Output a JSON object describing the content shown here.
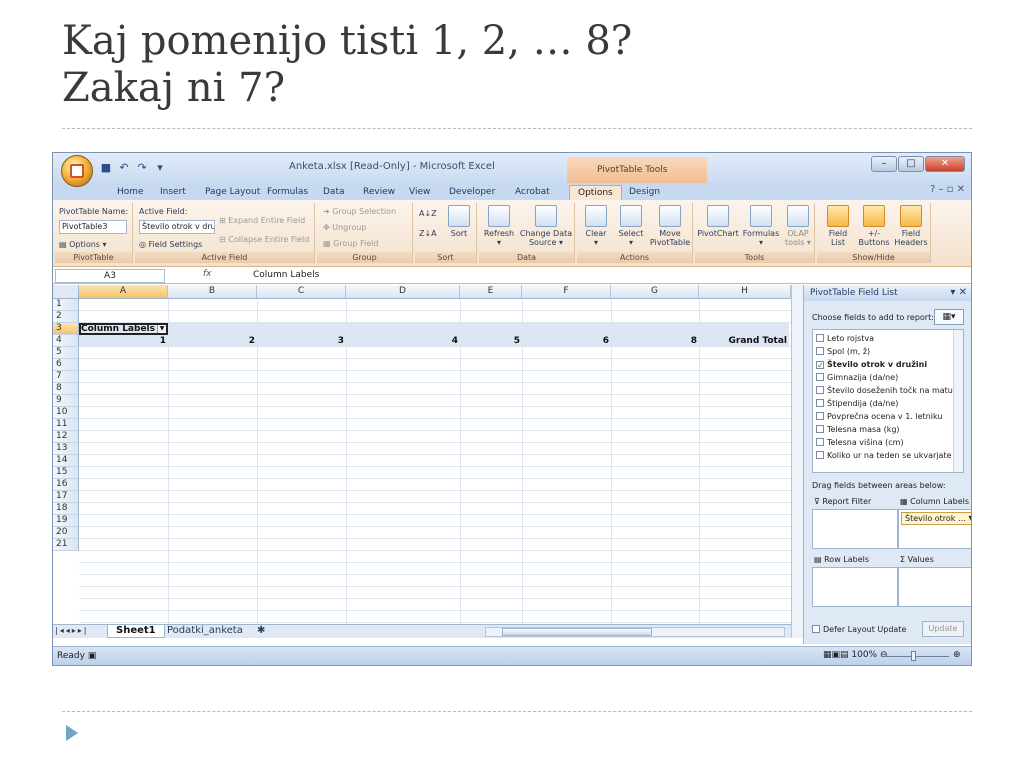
{
  "slide": {
    "title_line1": "Kaj pomenijo tisti 1, 2, … 8?",
    "title_line2": "Zakaj ni 7?"
  },
  "window": {
    "title": "Anketa.xlsx  [Read-Only] - Microsoft Excel",
    "context_tab_title": "PivotTable Tools"
  },
  "ribbon_tabs": [
    "Home",
    "Insert",
    "Page Layout",
    "Formulas",
    "Data",
    "Review",
    "View",
    "Developer",
    "Acrobat",
    "Options",
    "Design"
  ],
  "active_tab": "Options",
  "ribbon": {
    "pivottable": {
      "name_label": "PivotTable Name:",
      "name_value": "PivotTable3",
      "options": "Options",
      "group": "PivotTable"
    },
    "active_field": {
      "label": "Active Field:",
      "value": "Število otrok v dru",
      "field_settings": "Field Settings",
      "expand": "Expand Entire Field",
      "collapse": "Collapse Entire Field",
      "group": "Active Field"
    },
    "group_grp": {
      "group_selection": "Group Selection",
      "ungroup": "Ungroup",
      "group_field": "Group Field",
      "group": "Group"
    },
    "sort_grp": {
      "sort": "Sort",
      "group": "Sort"
    },
    "data_grp": {
      "refresh": "Refresh",
      "change_source_1": "Change Data",
      "change_source_2": "Source",
      "group": "Data"
    },
    "actions_grp": {
      "clear": "Clear",
      "select": "Select",
      "move_1": "Move",
      "move_2": "PivotTable",
      "group": "Actions"
    },
    "tools_grp": {
      "pivotchart": "PivotChart",
      "formulas": "Formulas",
      "olap_1": "OLAP",
      "olap_2": "tools",
      "group": "Tools"
    },
    "showhide_grp": {
      "field_list_1": "Field",
      "field_list_2": "List",
      "buttons_1": "+/-",
      "buttons_2": "Buttons",
      "headers_1": "Field",
      "headers_2": "Headers",
      "group": "Show/Hide"
    }
  },
  "formula_bar": {
    "name_box": "A3",
    "fx": "fx",
    "value": "Column Labels"
  },
  "columns": [
    "A",
    "B",
    "C",
    "D",
    "E",
    "F",
    "G",
    "H"
  ],
  "rows": [
    "1",
    "2",
    "3",
    "4",
    "5",
    "6",
    "7",
    "8",
    "9",
    "10",
    "11",
    "12",
    "13",
    "14",
    "15",
    "16",
    "17",
    "18",
    "19",
    "20",
    "21"
  ],
  "pivot": {
    "column_labels": "Column Labels",
    "headers": [
      "1",
      "2",
      "3",
      "4",
      "5",
      "6",
      "8"
    ],
    "grand_total": "Grand Total"
  },
  "sheets": {
    "active": "Sheet1",
    "other": "Podatki_anketa"
  },
  "status": {
    "ready": "Ready",
    "zoom": "100%"
  },
  "field_list": {
    "title": "PivotTable Field List",
    "choose": "Choose fields to add to report:",
    "fields": [
      {
        "label": "Leto rojstva",
        "checked": false
      },
      {
        "label": "Spol (m, ž)",
        "checked": false
      },
      {
        "label": "Število otrok v družini",
        "checked": true
      },
      {
        "label": "Gimnazija (da/ne)",
        "checked": false
      },
      {
        "label": "Število doseženih točk na maturi",
        "checked": false
      },
      {
        "label": "Štipendija (da/ne)",
        "checked": false
      },
      {
        "label": "Povprečna ocena v 1. letniku",
        "checked": false
      },
      {
        "label": "Telesna masa (kg)",
        "checked": false
      },
      {
        "label": "Telesna višina (cm)",
        "checked": false
      },
      {
        "label": "Koliko ur na teden se ukvarjate s špo…",
        "checked": false
      }
    ],
    "drag_text": "Drag fields between areas below:",
    "report_filter": "Report Filter",
    "column_labels": "Column Labels",
    "column_chip": "Število otrok …",
    "row_labels": "Row Labels",
    "values": "Values",
    "defer": "Defer Layout Update",
    "update": "Update"
  }
}
